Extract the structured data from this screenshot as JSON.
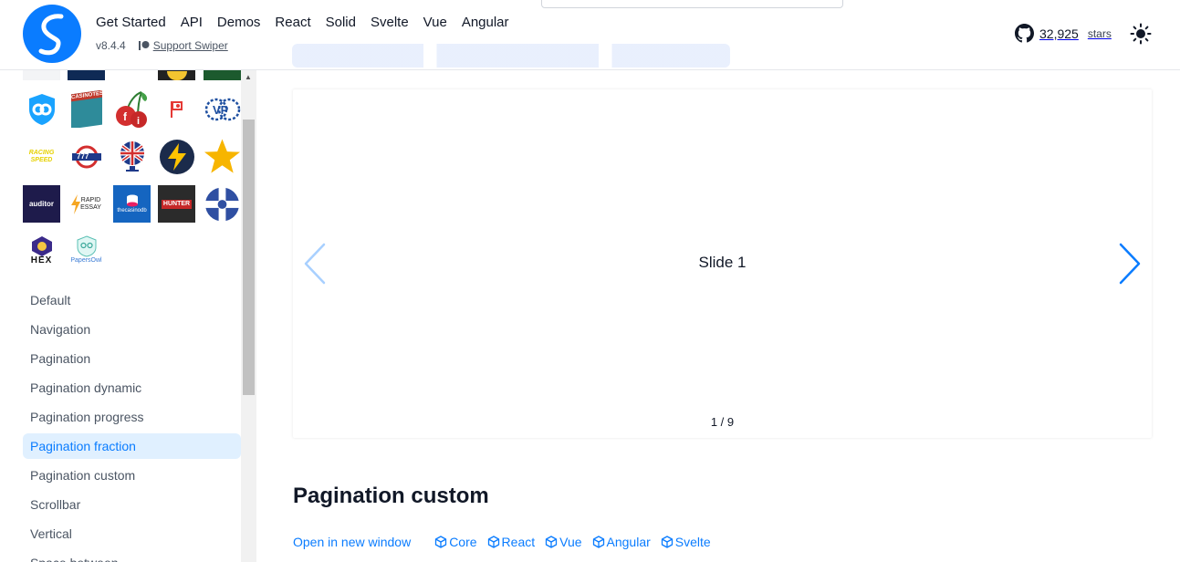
{
  "header": {
    "nav": [
      "Get Started",
      "API",
      "Demos",
      "React",
      "Solid",
      "Svelte",
      "Vue",
      "Angular"
    ],
    "version": "v8.4.4",
    "support_label": "Support Swiper",
    "github_count": "32,925",
    "github_stars_label": "stars"
  },
  "sponsors": {
    "casinotest_label": "CASINOTEST.dk",
    "racing_label": "RACING SPEED",
    "slots_label": "777",
    "auditor_label": "auditor",
    "rapid_label": "RAPID ESSAY",
    "casinodb_label": "thecasinodb",
    "hunter_label": "HUNTER",
    "hex_label": "HEX",
    "papersowl_label": "PapersOwl"
  },
  "sidebar": {
    "menu": [
      {
        "label": "Default"
      },
      {
        "label": "Navigation"
      },
      {
        "label": "Pagination"
      },
      {
        "label": "Pagination dynamic"
      },
      {
        "label": "Pagination progress"
      },
      {
        "label": "Pagination fraction"
      },
      {
        "label": "Pagination custom"
      },
      {
        "label": "Scrollbar"
      },
      {
        "label": "Vertical"
      },
      {
        "label": "Space between"
      }
    ],
    "active_index": 5
  },
  "demo": {
    "slide_label": "Slide 1",
    "pagination_fraction": "1 / 9"
  },
  "section": {
    "title": "Pagination custom",
    "open_link": "Open in new window",
    "frameworks": [
      "Core",
      "React",
      "Vue",
      "Angular",
      "Svelte"
    ]
  },
  "colors": {
    "accent": "#0a7cff",
    "active_bg": "#e0f0ff"
  }
}
